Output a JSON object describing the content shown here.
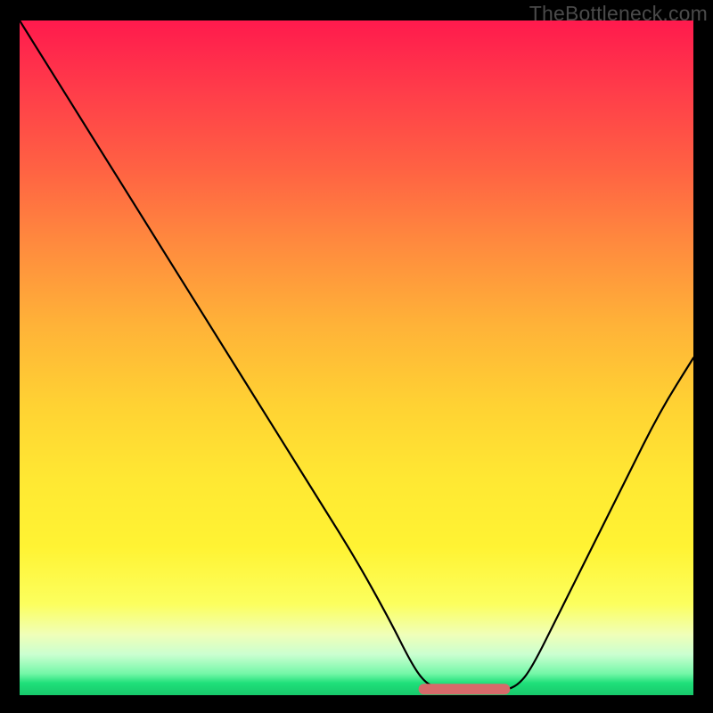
{
  "watermark": "TheBottleneck.com",
  "chart_data": {
    "type": "line",
    "title": "",
    "xlabel": "",
    "ylabel": "",
    "xlim": [
      0,
      100
    ],
    "ylim": [
      0,
      100
    ],
    "series": [
      {
        "name": "bottleneck-curve",
        "x": [
          0,
          5,
          10,
          15,
          20,
          25,
          30,
          35,
          40,
          45,
          50,
          55,
          58,
          60,
          62,
          65,
          70,
          72,
          74,
          76,
          80,
          85,
          90,
          95,
          100
        ],
        "values": [
          100,
          92,
          84,
          76,
          68,
          60,
          52,
          44,
          36,
          28,
          20,
          11,
          5,
          2,
          1,
          0.5,
          0.5,
          0.7,
          1.5,
          4,
          12,
          22,
          32,
          42,
          50
        ]
      }
    ],
    "annotations": [
      {
        "name": "optimal-range-marker",
        "x_start": 60,
        "x_end": 72,
        "y": 0.5
      }
    ],
    "gradient_stops": [
      {
        "pos": 0,
        "color": "#ff1a4d"
      },
      {
        "pos": 0.45,
        "color": "#ffb238"
      },
      {
        "pos": 0.78,
        "color": "#fff333"
      },
      {
        "pos": 0.92,
        "color": "#f0ffb8"
      },
      {
        "pos": 1.0,
        "color": "#17c86a"
      }
    ]
  }
}
